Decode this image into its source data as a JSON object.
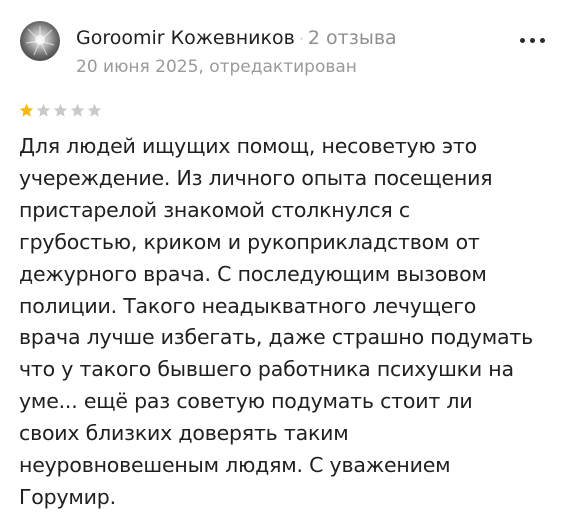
{
  "review": {
    "author_name": "Goroomir Кожевников",
    "separator": "·",
    "review_count": "2 отзыва",
    "date": "20 июня 2025, отредактирован",
    "rating": 1,
    "rating_max": 5,
    "colors": {
      "star_filled": "#fcb800",
      "star_empty": "#c9c9c9"
    },
    "text_lines": [
      "Для людей ищущих помощ, несоветую это",
      "учереждение. Из личного опыта посещения",
      "пристарелой знакомой столкнулся с",
      "грубостью, криком и рукоприкладством от",
      "дежурного врача. С последующим вызовом",
      "полиции. Такого неадыкватного лечущего",
      "врача лучше избегать, даже страшно подумать",
      "что у такого бывшего работника психушки на",
      "уме... ещё раз советую подумать стоит ли",
      "своих близких доверять таким",
      "неуровновешеным людям. С уважением",
      "Горумир."
    ],
    "icons": {
      "more": "more-dots-icon",
      "star": "star-icon"
    }
  }
}
